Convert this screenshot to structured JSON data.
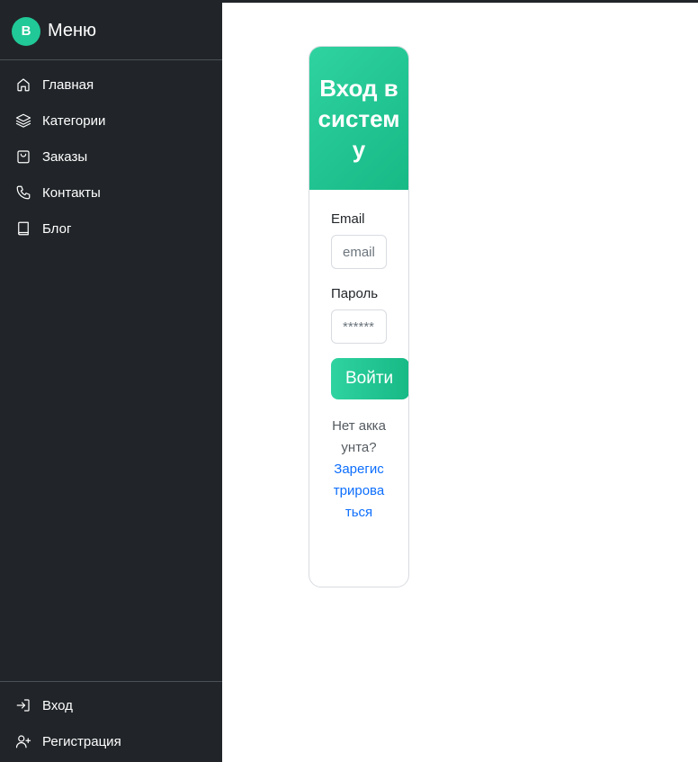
{
  "sidebar": {
    "brand_letter": "B",
    "title": "Меню",
    "items": [
      {
        "label": "Главная",
        "icon": "home-icon"
      },
      {
        "label": "Категории",
        "icon": "layers-icon"
      },
      {
        "label": "Заказы",
        "icon": "bag-icon"
      },
      {
        "label": "Контакты",
        "icon": "phone-icon"
      },
      {
        "label": "Блог",
        "icon": "book-icon"
      }
    ],
    "bottom_items": [
      {
        "label": "Вход",
        "icon": "login-icon"
      },
      {
        "label": "Регистрация",
        "icon": "user-plus-icon"
      }
    ]
  },
  "login_card": {
    "title": "Вход в систему",
    "email_label": "Email",
    "email_placeholder": "email",
    "password_label": "Пароль",
    "password_placeholder": "******",
    "submit_label": "Войти",
    "no_account_text": "Нет аккаунта?",
    "register_link": "Зарегистрироваться"
  },
  "colors": {
    "sidebar_bg": "#212529",
    "accent": "#20c997",
    "link": "#0d6efd"
  }
}
